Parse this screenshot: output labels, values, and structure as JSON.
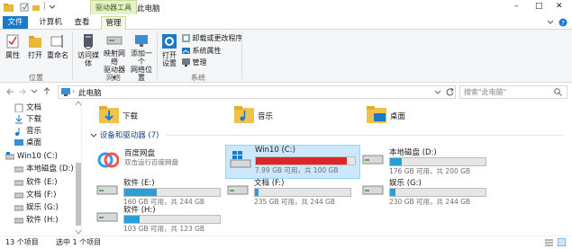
{
  "window": {
    "title": "此电脑",
    "context_tab": "驱动器工具",
    "qat_more": "|",
    "controls": {
      "minimize": "–",
      "maximize": "□",
      "close": "✕"
    },
    "help": "?"
  },
  "ribbon_tabs": [
    "文件",
    "计算机",
    "查看",
    "管理"
  ],
  "ribbon": {
    "groups": {
      "location": "位置",
      "network": "网络",
      "system": "系统"
    },
    "buttons": {
      "properties": "属性",
      "open": "打开",
      "rename": "重命名",
      "access_media": "访问媒体",
      "map_drive_1": "映射网络",
      "map_drive_2": "驱动器 ▾",
      "add_network_1": "添加一个",
      "add_network_2": "网络位置",
      "open_settings_1": "打开",
      "open_settings_2": "设置",
      "uninstall": "卸载或更改程序",
      "system_props": "系统属性",
      "manage": "管理"
    }
  },
  "address": {
    "path": "此电脑",
    "search_placeholder": "搜索\"此电脑\""
  },
  "nav": [
    {
      "label": "文档",
      "icon": "documents-icon"
    },
    {
      "label": "下载",
      "icon": "downloads-icon"
    },
    {
      "label": "音乐",
      "icon": "music-icon"
    },
    {
      "label": "桌面",
      "icon": "desktop-icon"
    },
    {
      "label": "Win10 (C:)",
      "icon": "system-drive-icon"
    },
    {
      "label": "本地磁盘 (D:)",
      "icon": "drive-icon"
    },
    {
      "label": "软件 (E:)",
      "icon": "drive-icon"
    },
    {
      "label": "文档 (F:)",
      "icon": "drive-icon"
    },
    {
      "label": "娱乐 (G:)",
      "icon": "drive-icon"
    },
    {
      "label": "软件 (H:)",
      "icon": "drive-icon"
    }
  ],
  "folders": [
    {
      "label": "下载",
      "icon": "downloads-folder-icon"
    },
    {
      "label": "音乐",
      "icon": "music-folder-icon"
    },
    {
      "label": "桌面",
      "icon": "desktop-folder-icon"
    }
  ],
  "section_title": "设备和驱动器 (7)",
  "drives": [
    {
      "name": "百度网盘",
      "caption": "双击运行百度网盘",
      "fill": null,
      "icon": "baidu-netdisk-icon"
    },
    {
      "name": "Win10 (C:)",
      "caption": "7.99 GB 可用，共 100 GB",
      "fill": 0.92,
      "icon": "windows-drive-icon",
      "selected": true,
      "bar_color": "#da2626"
    },
    {
      "name": "本地磁盘 (D:)",
      "caption": "176 GB 可用，共 200 GB",
      "fill": 0.12,
      "icon": "drive-icon"
    },
    {
      "name": "软件 (E:)",
      "caption": "160 GB 可用，共 244 GB",
      "fill": 0.34,
      "icon": "drive-icon"
    },
    {
      "name": "文档 (F:)",
      "caption": "235 GB 可用，共 244 GB",
      "fill": 0.04,
      "icon": "drive-icon"
    },
    {
      "name": "娱乐 (G:)",
      "caption": "230 GB 可用，共 244 GB",
      "fill": 0.06,
      "icon": "drive-icon"
    },
    {
      "name": "软件 (H:)",
      "caption": "103 GB 可用，共 123 GB",
      "fill": 0.16,
      "icon": "drive-icon"
    }
  ],
  "status": {
    "items": "13 个项目",
    "selected": "选中 1 个项目"
  },
  "colors": {
    "accent": "#1979ca",
    "bar": "#26a0da",
    "bar_low": "#da2626",
    "selection": "#cce8ff"
  }
}
